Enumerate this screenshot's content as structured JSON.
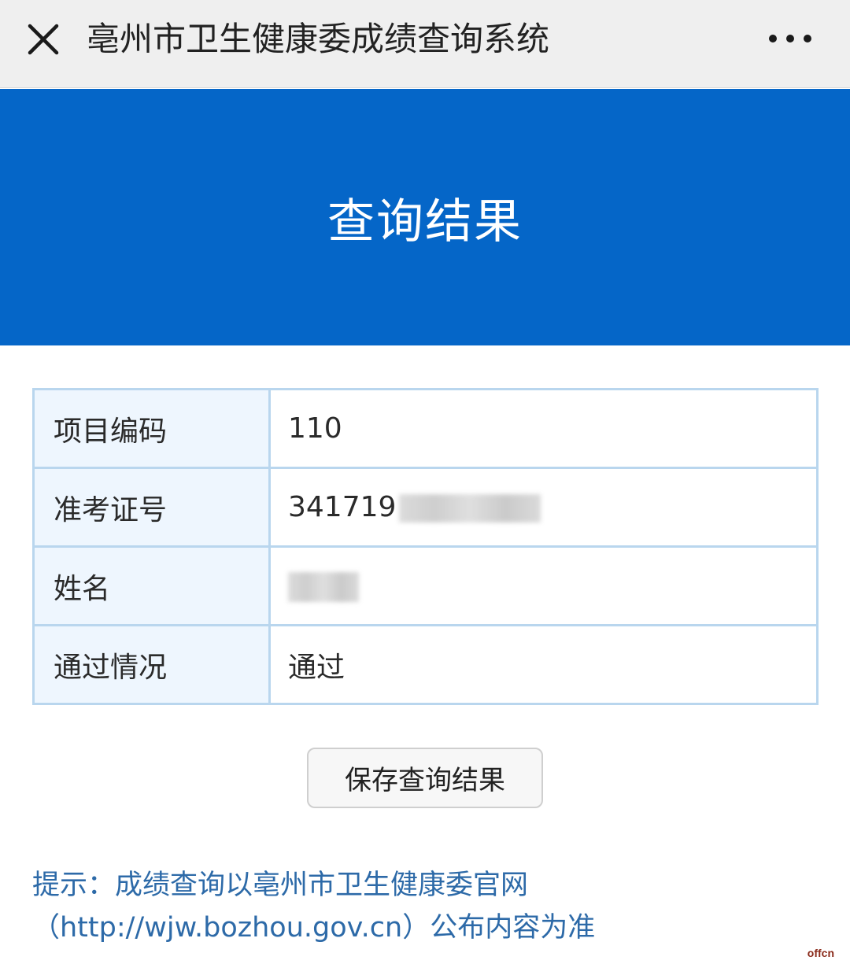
{
  "window": {
    "title": "亳州市卫生健康委成绩查询系统",
    "close_icon": "close-icon",
    "more_icon": "more-dots-icon"
  },
  "banner": {
    "title": "查询结果",
    "bg_color": "#0566c8"
  },
  "result": {
    "rows": [
      {
        "label": "项目编码",
        "value": "110"
      },
      {
        "label": "准考证号",
        "value": "341719"
      },
      {
        "label": "姓名",
        "value": ""
      },
      {
        "label": "通过情况",
        "value": "通过"
      }
    ]
  },
  "actions": {
    "save_label": "保存查询结果"
  },
  "tip": {
    "line1": "提示：成绩查询以亳州市卫生健康委官网",
    "line2": "（http://wjw.bozhou.gov.cn）公布内容为准",
    "color": "#2d6aa8"
  },
  "watermark": "offcn"
}
